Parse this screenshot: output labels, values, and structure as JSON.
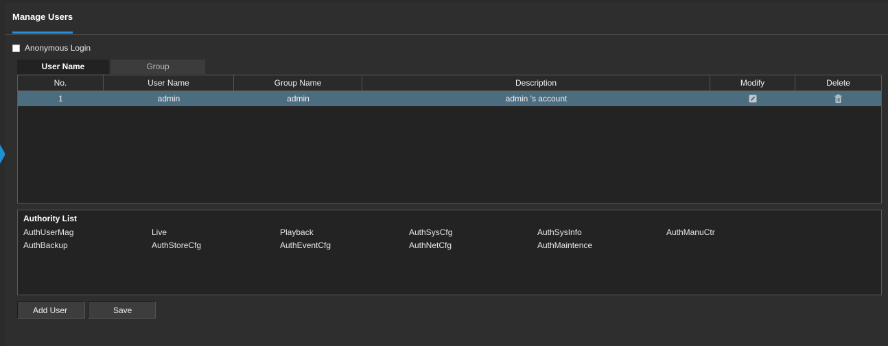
{
  "header": {
    "title": "Manage Users"
  },
  "anonymous_login": {
    "label": "Anonymous Login",
    "checked": false
  },
  "tabs": [
    {
      "label": "User Name",
      "active": true
    },
    {
      "label": "Group",
      "active": false
    }
  ],
  "table": {
    "columns": [
      "No.",
      "User Name",
      "Group Name",
      "Description",
      "Modify",
      "Delete"
    ],
    "rows": [
      {
        "no": "1",
        "user_name": "admin",
        "group_name": "admin",
        "description": "admin 's account",
        "modify_icon": "edit-icon",
        "delete_icon": "trash-icon"
      }
    ]
  },
  "authority": {
    "title": "Authority List",
    "items": [
      [
        "AuthUserMag",
        "Live",
        "Playback",
        "AuthSysCfg",
        "AuthSysInfo",
        "AuthManuCtr"
      ],
      [
        "AuthBackup",
        "AuthStoreCfg",
        "AuthEventCfg",
        "AuthNetCfg",
        "AuthMaintence"
      ]
    ]
  },
  "buttons": {
    "add_user": "Add User",
    "save": "Save"
  },
  "colors": {
    "accent": "#2a8fd8",
    "selected_row": "#4c6c80",
    "background": "#2e2e2e"
  }
}
